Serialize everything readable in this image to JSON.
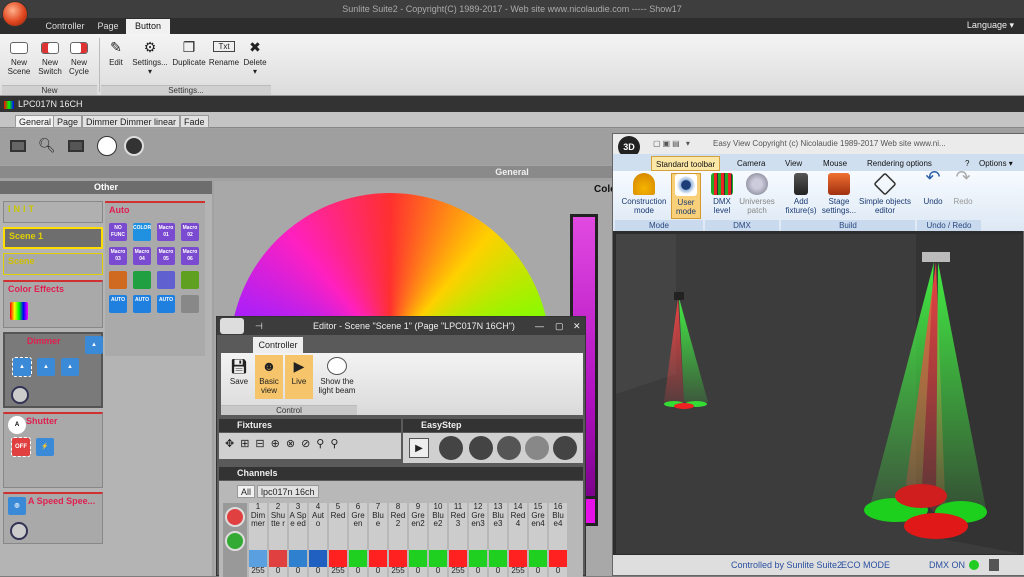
{
  "app": {
    "title": "Sunlite Suite2 - Copyright(C) 1989-2017 - Web site www.nicolaudie.com ----- Show17",
    "language": "Language"
  },
  "ribbon": {
    "tabs": [
      "Controller",
      "Page",
      "Button"
    ],
    "active_tab": "Button",
    "buttons": [
      {
        "label": "New Scene",
        "icon": "new-scene-icon"
      },
      {
        "label": "New Switch",
        "icon": "new-switch-icon"
      },
      {
        "label": "New Cycle",
        "icon": "new-cycle-icon"
      },
      {
        "label": "Edit",
        "icon": "edit-icon"
      },
      {
        "label": "Settings...",
        "icon": "gear-icon"
      },
      {
        "label": "Duplicate",
        "icon": "duplicate-icon"
      },
      {
        "label": "Rename",
        "icon": "rename-icon"
      },
      {
        "label": "Delete",
        "icon": "delete-icon"
      }
    ],
    "groups": {
      "new": "New",
      "settings": "Settings..."
    }
  },
  "page": {
    "title": "LPC017N 16CH",
    "tabs": [
      "General",
      "Page",
      "Dimmer Dimmer linear",
      "Fade"
    ],
    "active_tab": "General",
    "general_label": "General"
  },
  "other": {
    "header": "Other",
    "auto_label": "Auto",
    "init": "INIT",
    "scene1": "Scene 1",
    "scene": "Scene",
    "color_effects": "Color Effects",
    "dimmer": "Dimmer",
    "shutter": "Shutter",
    "aspeed": "A Speed Spee...",
    "auto_buttons": [
      "NO FUNC",
      "COLOR",
      "Macro 01",
      "Macro 02",
      "Macro 03",
      "Macro 04",
      "Macro 05",
      "Macro 06",
      "",
      "",
      "",
      "",
      "AUTO",
      "AUTO",
      "AUTO",
      ""
    ]
  },
  "color_label": "Colo",
  "editor": {
    "title": "Editor - Scene \"Scene 1\" (Page \"LPC017N 16CH\")",
    "tab": "Controller",
    "buttons": [
      "Save",
      "Basic view",
      "Live",
      "Show the light beam"
    ],
    "group": "Control",
    "fixtures": "Fixtures",
    "easystep": "EasyStep",
    "channels": "Channels",
    "channel_tabs": [
      "All",
      "lpc017n 16ch"
    ],
    "channel_numbers": [
      "1",
      "2",
      "3",
      "4",
      "5",
      "6",
      "7",
      "8",
      "9",
      "10",
      "11",
      "12",
      "13",
      "14",
      "15",
      "16"
    ],
    "channel_names": [
      "Dim mer",
      "Shu tte r",
      "A Spe ed",
      "Aut o",
      "Red",
      "Gre en",
      "Blu e",
      "Red 2",
      "Gre en2",
      "Blu e2",
      "Red 3",
      "Gre en3",
      "Blu e3",
      "Red 4",
      "Gre en4",
      "Blu e4"
    ],
    "channel_values": [
      "255",
      "0",
      "0",
      "0",
      "255",
      "0",
      "0",
      "255",
      "0",
      "0",
      "255",
      "0",
      "0",
      "255",
      "0",
      "0"
    ],
    "channel_colors": [
      "#5aa0e0",
      "#e04040",
      "#3080d0",
      "#2060c0",
      "#ff2020",
      "#20d020",
      "#ff2020",
      "#ff2020",
      "#20d020",
      "#20d020",
      "#ff2020",
      "#20d020",
      "#20d020",
      "#ff2020",
      "#20d020",
      "#ff2020"
    ]
  },
  "easyview": {
    "title": "Easy View  Copyright (c) Nicolaudie 1989-2017   Web site www.ni...",
    "tabs": [
      "Standard toolbar",
      "Camera",
      "View",
      "Mouse",
      "Rendering options"
    ],
    "help": "?",
    "options": "Options",
    "buttons": [
      {
        "label": "Construction mode",
        "icon": "helmet-icon"
      },
      {
        "label": "User mode",
        "icon": "eye-icon"
      },
      {
        "label": "DMX level",
        "icon": "dmx-level-icon"
      },
      {
        "label": "Universes patch",
        "icon": "universe-icon"
      },
      {
        "label": "Add fixture(s)",
        "icon": "fixture-icon"
      },
      {
        "label": "Stage settings...",
        "icon": "stage-icon"
      },
      {
        "label": "Simple objects editor",
        "icon": "cube-icon"
      },
      {
        "label": "Undo",
        "icon": "undo-icon"
      },
      {
        "label": "Redo",
        "icon": "redo-icon"
      }
    ],
    "groups": [
      "Mode",
      "DMX",
      "Build",
      "Undo / Redo"
    ],
    "status": {
      "controlled": "Controlled by Sunlite Suite2",
      "eco": "ECO MODE",
      "dmx": "DMX ON"
    }
  }
}
